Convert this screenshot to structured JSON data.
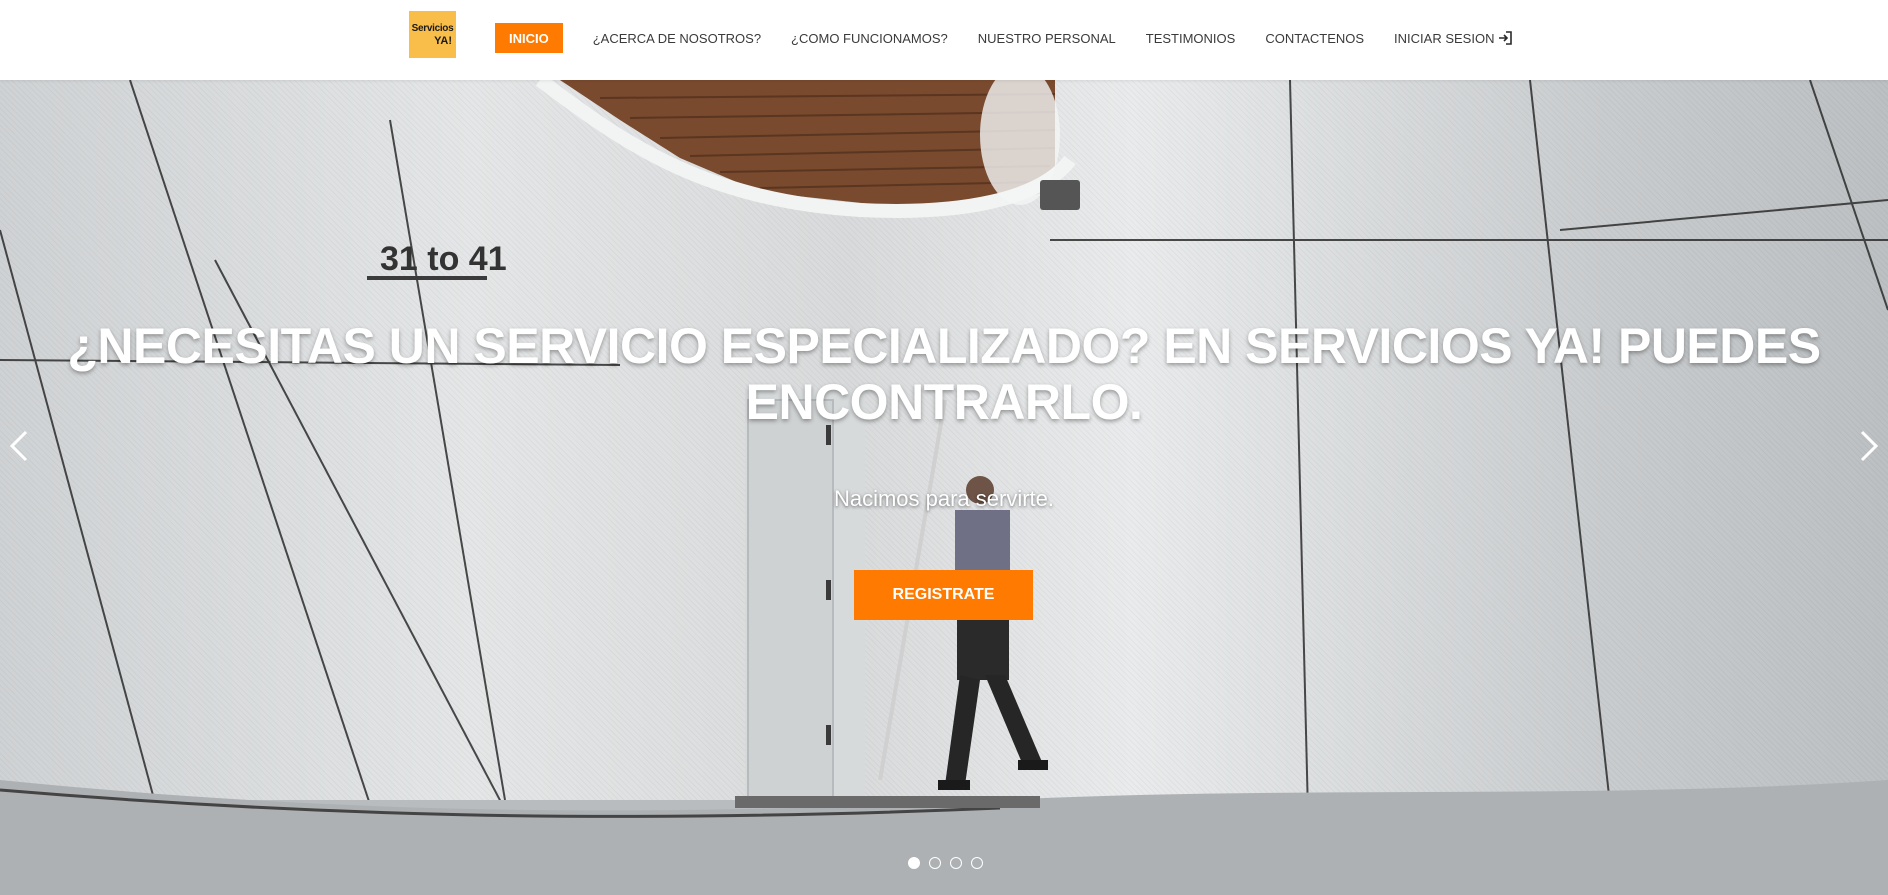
{
  "brand": {
    "logo_line1": "Servicios",
    "logo_line2": "YA!",
    "logo_color": "#f9bd4a"
  },
  "nav": {
    "items": [
      {
        "label": "INICIO",
        "active": true
      },
      {
        "label": "¿ACERCA DE NOSOTROS?",
        "active": false
      },
      {
        "label": "¿COMO FUNCIONAMOS?",
        "active": false
      },
      {
        "label": "NUESTRO PERSONAL",
        "active": false
      },
      {
        "label": "TESTIMONIOS",
        "active": false
      },
      {
        "label": "CONTACTENOS",
        "active": false
      },
      {
        "label": "INICIAR SESION",
        "active": false,
        "icon": "login-icon"
      }
    ]
  },
  "hero": {
    "title_line1": "¿NECESITAS UN SERVICIO ESPECIALIZADO? EN SERVICIOS YA! PUEDES",
    "title_line2": "ENCONTRARLO.",
    "subtitle": "Nacimos para servirte.",
    "cta_label": "REGISTRATE",
    "slides_total": 4,
    "active_slide": 1,
    "prev_icon": "chevron-left-icon",
    "next_icon": "chevron-right-icon"
  },
  "colors": {
    "accent": "#ff7a00",
    "header_bg": "#ffffff",
    "nav_text": "#3a3a3a"
  }
}
